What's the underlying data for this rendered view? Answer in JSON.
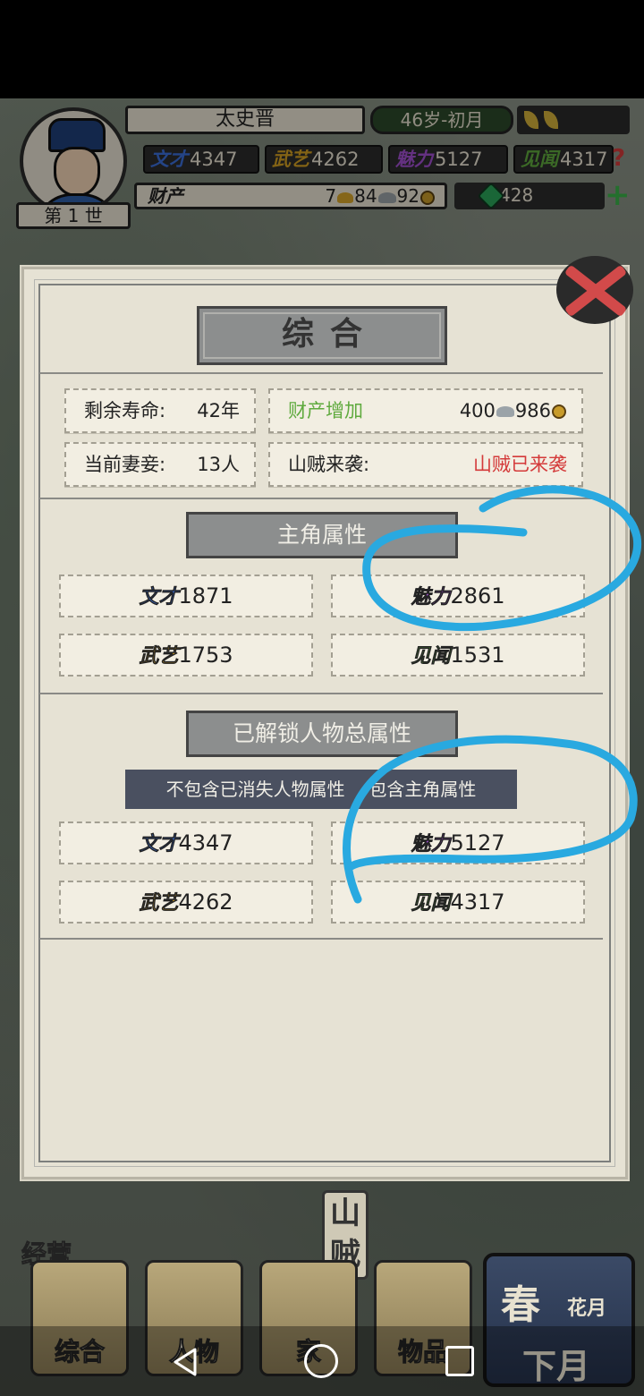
{
  "header": {
    "generation": "第 1 世",
    "name": "太史晋",
    "age": "46岁-初月",
    "stats": [
      {
        "tag": "文才",
        "value": "4347"
      },
      {
        "tag": "武艺",
        "value": "4262"
      },
      {
        "tag": "魅力",
        "value": "5127"
      },
      {
        "tag": "见闻",
        "value": "4317"
      }
    ],
    "help_icon": "?",
    "wealth_label": "财产",
    "wealth": {
      "gold": "7",
      "silver": "84",
      "coins": "92"
    },
    "jade": "428",
    "plus_icon": "+"
  },
  "dialog": {
    "title": "综合",
    "info": {
      "lifespan_label": "剩余寿命:",
      "lifespan_value": "42年",
      "wealth_increase_label": "财产增加",
      "wealth_increase_silver": "400",
      "wealth_increase_coins": "986",
      "wives_label": "当前妻妾:",
      "wives_value": "13人",
      "bandit_label": "山贼来袭:",
      "bandit_status": "山贼已来袭"
    },
    "protagonist": {
      "title": "主角属性",
      "attrs": [
        {
          "tag": "文才",
          "value": "1871"
        },
        {
          "tag": "魅力",
          "value": "2861"
        },
        {
          "tag": "武艺",
          "value": "1753"
        },
        {
          "tag": "见闻",
          "value": "1531"
        }
      ]
    },
    "unlocked": {
      "title": "已解锁人物总属性",
      "note_left": "不包含已消失人物属性",
      "note_right": "包含主角属性",
      "attrs": [
        {
          "tag": "文才",
          "value": "4347"
        },
        {
          "tag": "魅力",
          "value": "5127"
        },
        {
          "tag": "武艺",
          "value": "4262"
        },
        {
          "tag": "见闻",
          "value": "4317"
        }
      ]
    }
  },
  "bottom": {
    "section_label": "经营",
    "bandit_tag": "山贼",
    "tabs": [
      {
        "label": "综合"
      },
      {
        "label": "人物"
      },
      {
        "label": "家"
      },
      {
        "label": "物品"
      }
    ],
    "season_big": "春",
    "season_small": "花月",
    "next_month": "下月"
  },
  "colors": {
    "wen": "#3b6fd8",
    "wu": "#d4a022",
    "mei": "#a24fd0",
    "jian": "#5faa3e",
    "alert_red": "#d43a3a",
    "annotation_blue": "#29a9e0"
  }
}
